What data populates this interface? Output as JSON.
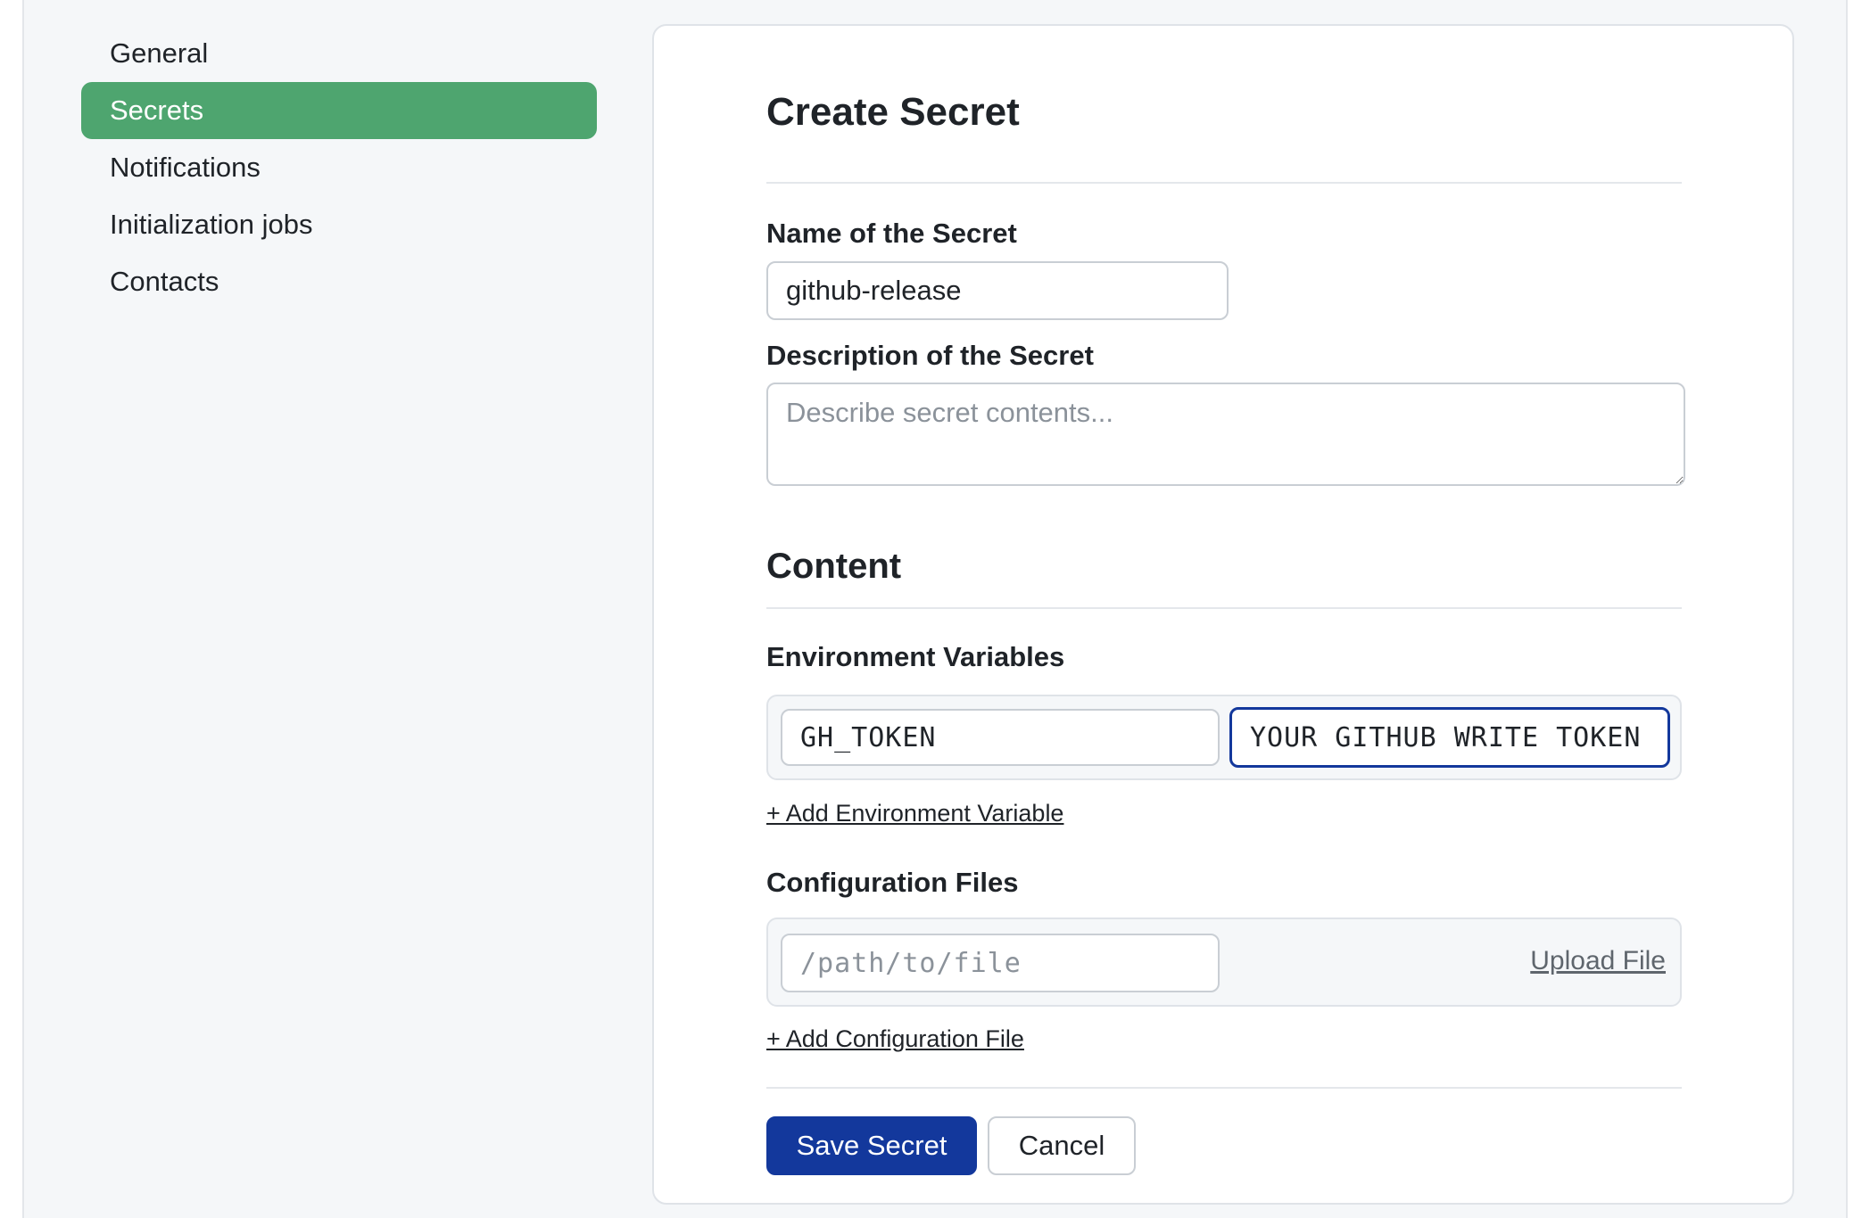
{
  "sidebar": {
    "items": [
      {
        "label": "General",
        "active": false
      },
      {
        "label": "Secrets",
        "active": true
      },
      {
        "label": "Notifications",
        "active": false
      },
      {
        "label": "Initialization jobs",
        "active": false
      },
      {
        "label": "Contacts",
        "active": false
      }
    ]
  },
  "form": {
    "title": "Create Secret",
    "name_label": "Name of the Secret",
    "name_value": "github-release",
    "description_label": "Description of the Secret",
    "description_placeholder": "Describe secret contents...",
    "content_heading": "Content",
    "env_label": "Environment Variables",
    "env_name_value": "GH_TOKEN",
    "env_value_value": "YOUR GITHUB WRITE TOKEN",
    "add_env_link": "+ Add Environment Variable",
    "config_label": "Configuration Files",
    "config_path_placeholder": "/path/to/file",
    "upload_link": "Upload File",
    "add_config_link": "+ Add Configuration File",
    "save_button": "Save Secret",
    "cancel_button": "Cancel"
  },
  "colors": {
    "active_nav": "#4ea56f",
    "primary_button": "#13389c",
    "focus_border": "#13389c"
  }
}
